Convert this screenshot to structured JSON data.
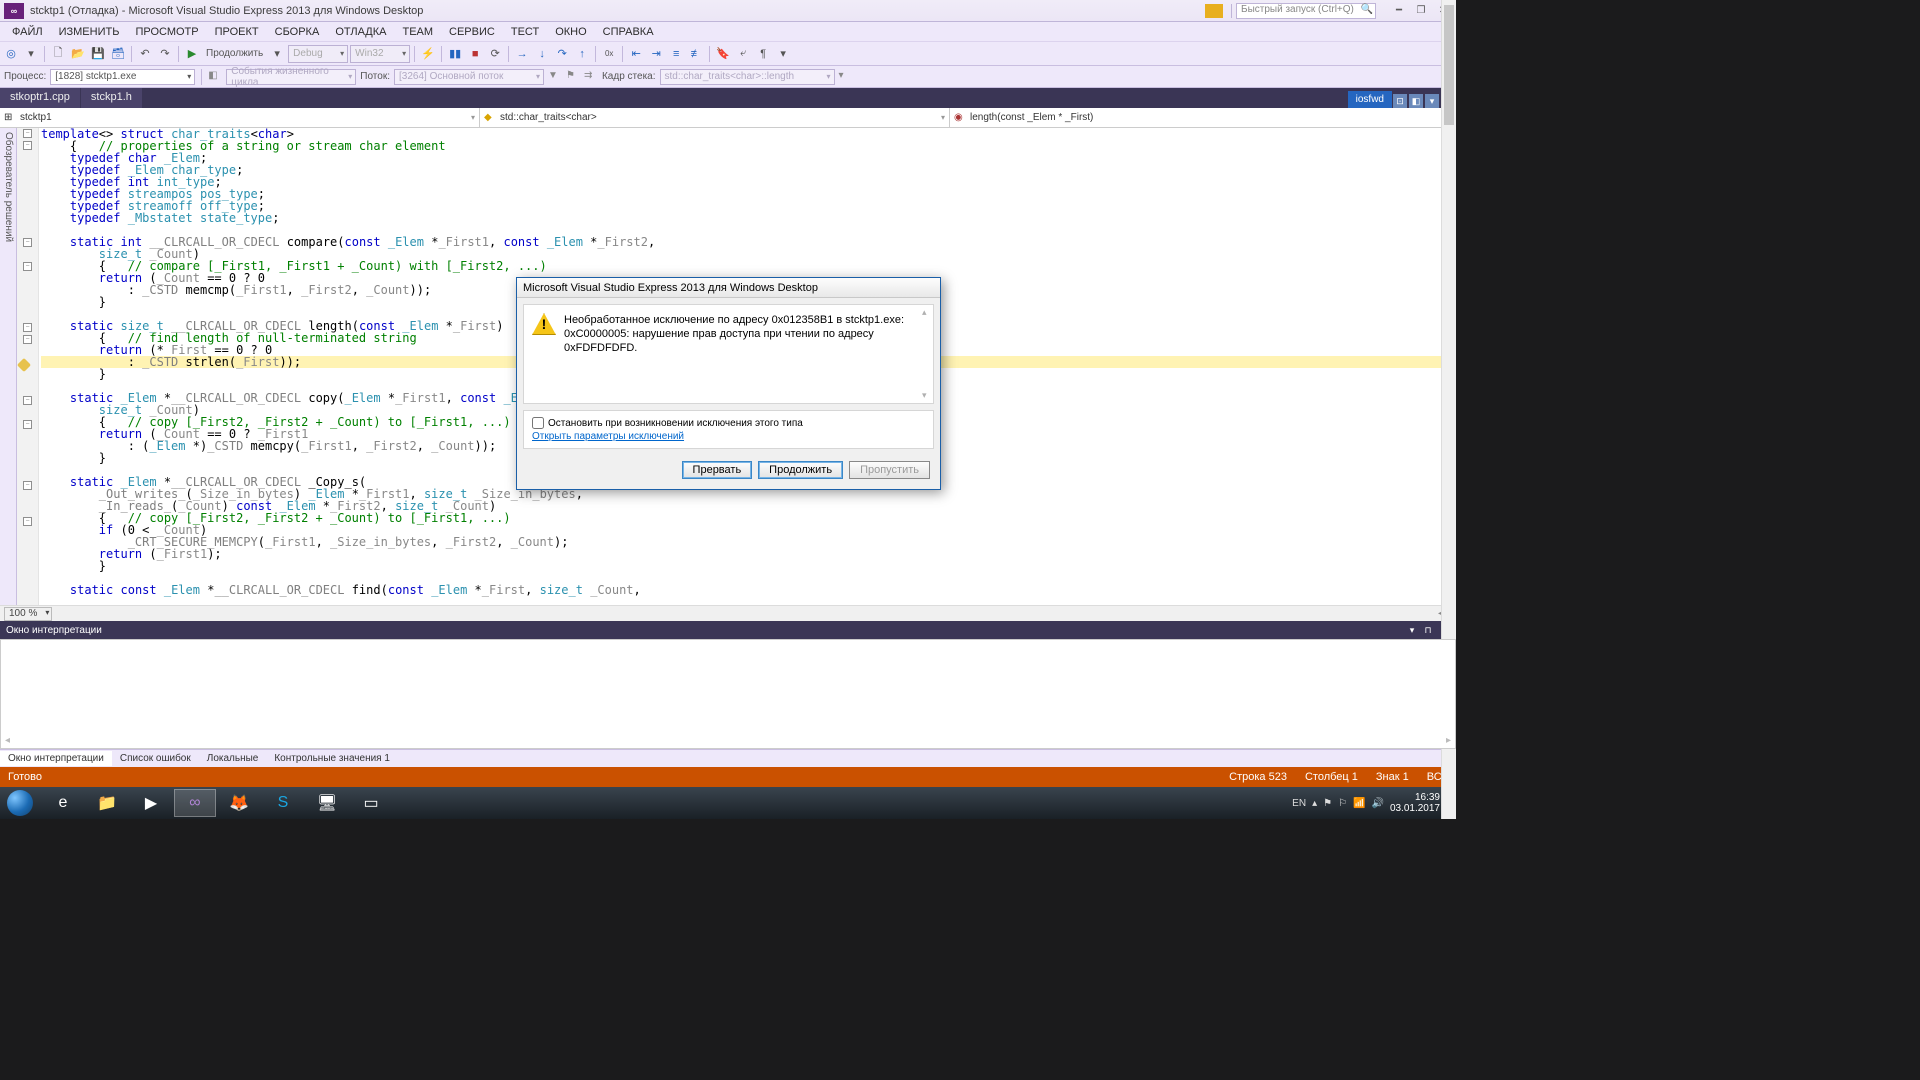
{
  "title": "stcktp1 (Отладка) - Microsoft Visual Studio Express 2013 для Windows Desktop",
  "search_placeholder": "Быстрый запуск (Ctrl+Q)",
  "menu": [
    "ФАЙЛ",
    "ИЗМЕНИТЬ",
    "ПРОСМОТР",
    "ПРОЕКТ",
    "СБОРКА",
    "ОТЛАДКА",
    "TEAM",
    "СЕРВИС",
    "ТЕСТ",
    "ОКНО",
    "СПРАВКА"
  ],
  "toolbar": {
    "continue": "Продолжить",
    "debug": "Debug",
    "platform": "Win32"
  },
  "toolbar2": {
    "process_label": "Процесс:",
    "process": "[1828] stcktp1.exe",
    "lifecycle": "События жизненного цикла",
    "thread_label": "Поток:",
    "thread": "[3264] Основной поток",
    "stack_label": "Кадр стека:",
    "stack": "std::char_traits<char>::length"
  },
  "tabs": {
    "t1": "stkoptr1.cpp",
    "t2": "stckp1.h",
    "right": "iosfwd"
  },
  "nav": {
    "c1": "stcktp1",
    "c2": "std::char_traits<char>",
    "c3": "length(const _Elem * _First)"
  },
  "sidebar": "Обозреватель решений",
  "zoom": "100 %",
  "panel": {
    "title": "Окно интерпретации"
  },
  "panel_tabs": [
    "Окно интерпретации",
    "Список ошибок",
    "Локальные",
    "Контрольные значения 1"
  ],
  "status": {
    "ready": "Готово",
    "line": "Строка 523",
    "col": "Столбец 1",
    "ch": "Знак 1",
    "ins": "ВСТ"
  },
  "dialog": {
    "title": "Microsoft Visual Studio Express 2013 для Windows Desktop",
    "msg": "Необработанное исключение по адресу 0x012358B1 в stcktp1.exe: 0xC0000005: нарушение прав доступа при чтении по адресу 0xFDFDFDFD.",
    "chk": "Остановить при возникновении исключения этого типа",
    "link": "Открыть параметры исключений",
    "b1": "Прервать",
    "b2": "Продолжить",
    "b3": "Пропустить"
  },
  "tray": {
    "lang": "EN",
    "time": "16:39",
    "date": "03.01.2017"
  },
  "code": "<span class='kw'>template</span>&lt;&gt; <span class='kw'>struct</span> <span class='ty'>char_traits</span>&lt;<span class='kw'>char</span>&gt;\n    {   <span class='cm'>// properties of a string or stream char element</span>\n    <span class='kw'>typedef</span> <span class='kw'>char</span> <span class='ty'>_Elem</span>;\n    <span class='kw'>typedef</span> <span class='ty'>_Elem</span> <span class='ty'>char_type</span>;\n    <span class='kw'>typedef</span> <span class='kw'>int</span> <span class='ty'>int_type</span>;\n    <span class='kw'>typedef</span> <span class='ty'>streampos</span> <span class='ty'>pos_type</span>;\n    <span class='kw'>typedef</span> <span class='ty'>streamoff</span> <span class='ty'>off_type</span>;\n    <span class='kw'>typedef</span> <span class='ty'>_Mbstatet</span> <span class='ty'>state_type</span>;\n\n    <span class='kw'>static</span> <span class='kw'>int</span> <span class='ma'>__CLRCALL_OR_CDECL</span> compare(<span class='kw'>const</span> <span class='ty'>_Elem</span> *<span class='id'>_First1</span>, <span class='kw'>const</span> <span class='ty'>_Elem</span> *<span class='id'>_First2</span>,\n        <span class='ty'>size_t</span> <span class='id'>_Count</span>)\n        {   <span class='cm'>// compare [_First1, _First1 + _Count) with [_First2, ...)</span>\n        <span class='kw'>return</span> (<span class='id'>_Count</span> == 0 ? 0\n            : <span class='ma'>_CSTD</span> memcmp(<span class='id'>_First1</span>, <span class='id'>_First2</span>, <span class='id'>_Count</span>));\n        }\n\n    <span class='kw'>static</span> <span class='ty'>size_t</span> <span class='ma'>__CLRCALL_OR_CDECL</span> length(<span class='kw'>const</span> <span class='ty'>_Elem</span> *<span class='id'>_First</span>)\n        {   <span class='cm'>// find length of null-terminated string</span>\n        <span class='kw'>return</span> (*<span class='id'>_First</span> == 0 ? 0\n<span class='hl'>            : <span class='ma'>_CSTD</span> strlen(<span class='id'>_First</span>));</span>\n        }\n\n    <span class='kw'>static</span> <span class='ty'>_Elem</span> *<span class='ma'>__CLRCALL_OR_CDECL</span> copy(<span class='ty'>_Elem</span> *<span class='id'>_First1</span>, <span class='kw'>const</span> <span class='ty'>_Elem</span> *<span class='id'>_First2</span>,\n        <span class='ty'>size_t</span> <span class='id'>_Count</span>)\n        {   <span class='cm'>// copy [_First2, _First2 + _Count) to [_First1, ...)</span>\n        <span class='kw'>return</span> (<span class='id'>_Count</span> == 0 ? <span class='id'>_First1</span>\n            : (<span class='ty'>_Elem</span> *)<span class='ma'>_CSTD</span> memcpy(<span class='id'>_First1</span>, <span class='id'>_First2</span>, <span class='id'>_Count</span>));\n        }\n\n    <span class='kw'>static</span> <span class='ty'>_Elem</span> *<span class='ma'>__CLRCALL_OR_CDECL</span> _Copy_s(\n        <span class='ma'>_Out_writes_</span>(<span class='id'>_Size_in_bytes</span>) <span class='ty'>_Elem</span> *<span class='id'>_First1</span>, <span class='ty'>size_t</span> <span class='id'>_Size_in_bytes</span>,\n        <span class='ma'>_In_reads_</span>(<span class='id'>_Count</span>) <span class='kw'>const</span> <span class='ty'>_Elem</span> *<span class='id'>_First2</span>, <span class='ty'>size_t</span> <span class='id'>_Count</span>)\n        {   <span class='cm'>// copy [_First2, _First2 + _Count) to [_First1, ...)</span>\n        <span class='kw'>if</span> (0 &lt; <span class='id'>_Count</span>)\n            <span class='ma'>_CRT_SECURE_MEMCPY</span>(<span class='id'>_First1</span>, <span class='id'>_Size_in_bytes</span>, <span class='id'>_First2</span>, <span class='id'>_Count</span>);\n        <span class='kw'>return</span> (<span class='id'>_First1</span>);\n        }\n\n    <span class='kw'>static</span> <span class='kw'>const</span> <span class='ty'>_Elem</span> *<span class='ma'>__CLRCALL_OR_CDECL</span> find(<span class='kw'>const</span> <span class='ty'>_Elem</span> *<span class='id'>_First</span>, <span class='ty'>size_t</span> <span class='id'>_Count</span>,"
}
